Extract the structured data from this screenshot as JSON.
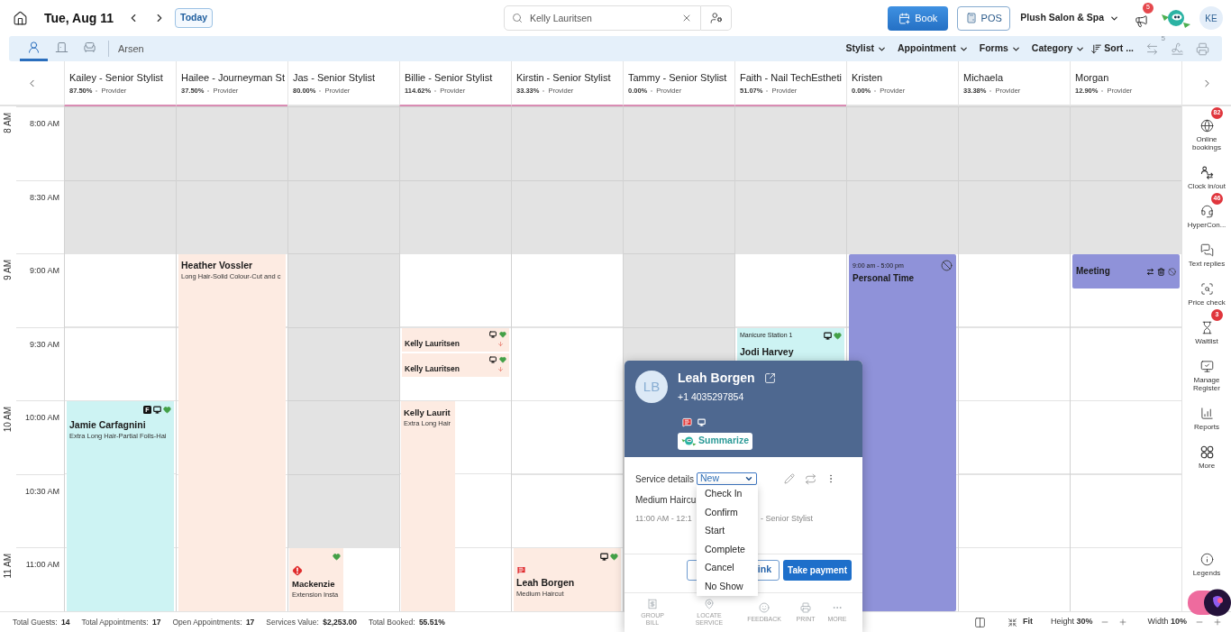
{
  "top_bar": {
    "date": "Tue, Aug 11",
    "today_button": "Today",
    "search": {
      "value": "Kelly Lauritsen"
    },
    "book_button": "Book",
    "pos_button": "POS",
    "business": "Plush Salon & Spa",
    "announcements_badge": "5",
    "user_initials": "KE"
  },
  "toolbar": {
    "views": [
      {
        "selected": true
      },
      {
        "selected": false
      },
      {
        "selected": false
      }
    ],
    "location": "Arsen",
    "filters": [
      "Stylist",
      "Appointment",
      "Forms",
      "Category"
    ],
    "sort": "Sort ...",
    "sync_badge": "5"
  },
  "time_slots": [
    {
      "hour_label": "8 AM",
      "label": "8:00 AM"
    },
    {
      "label": "8:30 AM"
    },
    {
      "hour_label": "9 AM",
      "label": "9:00 AM"
    },
    {
      "label": "9:30 AM"
    },
    {
      "hour_label": "10 AM",
      "label": "10:00 AM"
    },
    {
      "label": "10:30 AM"
    },
    {
      "hour_label": "11 AM",
      "label": "11:00 AM"
    }
  ],
  "stylists": [
    {
      "name": "Kailey - Senior Stylist",
      "booked": "87.50%",
      "role": "Provider",
      "underlined": true,
      "slots": [
        {
          "available": false
        },
        {
          "available": false
        },
        {
          "available": true
        },
        {
          "available": true
        },
        {
          "available": true,
          "appointments": [
            {
              "kind": "appointment",
              "client": "Jamie Carfagnini",
              "service": "Extra Long Hair-Partial Foils-Hai",
              "color": "#cdf3f3",
              "half_width": false,
              "indicators": [
                {
                  "kind": "letter",
                  "text": "F"
                },
                {
                  "kind": "monitor"
                },
                {
                  "kind": "heart"
                }
              ]
            }
          ]
        }
      ]
    },
    {
      "name": "Hailee - Journeyman St",
      "booked": "37.50%",
      "role": "Provider",
      "underlined": true,
      "slots": [
        {
          "available": false
        },
        {
          "available": false
        },
        {
          "available": true,
          "appointments": [
            {
              "kind": "appointment",
              "client": "Heather Vossler",
              "service": "Long Hair-Solid Colour-Cut and c",
              "color": "#fdebe2",
              "half_width": false
            }
          ]
        }
      ]
    },
    {
      "name": "Jas - Senior Stylist",
      "booked": "80.00%",
      "role": "Provider",
      "underlined": false,
      "slots": [
        {
          "available": false
        },
        {
          "available": false
        },
        {
          "available": false
        },
        {
          "available": false
        },
        {
          "available": false
        },
        {
          "available": false
        },
        {
          "available": true,
          "appointments": [
            {
              "kind": "appointment",
              "client": "Mackenzie",
              "service": "Extension Insta",
              "color": "#fdebe2",
              "half_width": true,
              "flag": {
                "kind": "alert"
              },
              "indicators": [
                {
                  "kind": "heart"
                }
              ]
            }
          ]
        }
      ]
    },
    {
      "name": "Billie - Senior Stylist",
      "booked": "114.62%",
      "role": "Provider",
      "underlined": true,
      "slots": [
        {
          "available": false
        },
        {
          "available": false
        },
        {
          "available": true
        },
        {
          "available": true,
          "appointments": [
            {
              "kind": "appointment",
              "client": "Kelly Lauritsen",
              "color": "#fdebe2",
              "half_width": false,
              "indicators": [
                {
                  "kind": "monitor"
                },
                {
                  "kind": "heart"
                },
                {
                  "kind": "arrow-down"
                }
              ]
            },
            {
              "kind": "appointment",
              "client": "Kelly Lauritsen",
              "color": "#fdebe2",
              "half_width": false,
              "indicators": [
                {
                  "kind": "monitor"
                },
                {
                  "kind": "heart"
                },
                {
                  "kind": "arrow-down"
                }
              ]
            }
          ]
        },
        {
          "available": true,
          "appointments": [
            {
              "kind": "appointment",
              "client": "Kelly Laurit",
              "service": "Extra Long Hair",
              "color": "#fdebe2",
              "half_width": true
            }
          ]
        }
      ]
    },
    {
      "name": "Kirstin - Senior Stylist",
      "booked": "33.33%",
      "role": "Provider",
      "underlined": true,
      "slots": [
        {
          "available": false
        },
        {
          "available": false
        },
        {
          "available": true
        },
        {
          "available": true
        },
        {
          "available": true
        },
        {
          "available": true
        },
        {
          "available": true,
          "appointments": [
            {
              "kind": "appointment",
              "client": "Leah Borgen",
              "service": "Medium Haircut",
              "color": "#fdebe2",
              "half_width": false,
              "flag": {
                "kind": "note"
              },
              "indicators": [
                {
                  "kind": "monitor"
                },
                {
                  "kind": "heart"
                }
              ]
            }
          ]
        }
      ]
    },
    {
      "name": "Tammy - Senior Stylist",
      "booked": "0.00%",
      "role": "Provider",
      "underlined": true,
      "slots": [
        {
          "available": false
        },
        {
          "available": false
        },
        {
          "available": false
        },
        {
          "available": false
        }
      ]
    },
    {
      "name": "Faith - Nail TechEstheti",
      "booked": "51.07%",
      "role": "Provider",
      "underlined": true,
      "slots": [
        {
          "available": false
        },
        {
          "available": false
        },
        {
          "available": true
        },
        {
          "available": true,
          "appointments": [
            {
              "kind": "appointment",
              "station": "Manicure Station 1",
              "client": "Jodi Harvey",
              "color": "#cdf3f3",
              "half_width": false,
              "indicators": [
                {
                  "kind": "monitor"
                },
                {
                  "kind": "heart"
                }
              ]
            }
          ]
        }
      ]
    },
    {
      "name": "Kristen",
      "booked": "0.00%",
      "role": "Provider",
      "underlined": false,
      "slots": [
        {
          "available": false
        },
        {
          "available": false
        },
        {
          "available": true,
          "appointments": [
            {
              "kind": "block",
              "time": "9:00 am - 5:00 pm",
              "title": "Personal Time",
              "color": "#8f92d9",
              "half_width": false,
              "indicators": [
                {
                  "kind": "blocked"
                }
              ]
            }
          ]
        }
      ]
    },
    {
      "name": "Michaela",
      "booked": "33.38%",
      "role": "Provider",
      "underlined": false,
      "slots": [
        {
          "available": false
        },
        {
          "available": false
        },
        {
          "available": true
        },
        {
          "available": true
        },
        {
          "available": true
        },
        {
          "available": true
        },
        {
          "available": true
        }
      ]
    },
    {
      "name": "Morgan",
      "booked": "12.90%",
      "role": "Provider",
      "underlined": false,
      "slots": [
        {
          "available": false
        },
        {
          "available": false
        },
        {
          "available": true,
          "appointments": [
            {
              "kind": "block",
              "title": "Meeting",
              "color": "#8f92d9",
              "half_width": false,
              "indicators": [
                {
                  "kind": "swap"
                },
                {
                  "kind": "trash"
                },
                {
                  "kind": "blocked"
                }
              ]
            }
          ]
        },
        {
          "available": true
        },
        {
          "available": true
        },
        {
          "available": true
        },
        {
          "available": true
        }
      ]
    }
  ],
  "popup": {
    "initials": "LB",
    "client": "Leah Borgen",
    "phone": "+1 4035297854",
    "indicators": [
      {
        "kind": "note"
      },
      {
        "kind": "monitor"
      }
    ],
    "summarize_button": "Summarize",
    "section_label": "Service details",
    "status": {
      "value": "New",
      "expanded": true,
      "options": [
        {
          "label": "Check In",
          "selected": false
        },
        {
          "label": "Confirm",
          "selected": false
        },
        {
          "label": "Start",
          "selected": false
        },
        {
          "label": "Complete",
          "selected": false
        },
        {
          "label": "Cancel",
          "selected": false
        },
        {
          "label": "No Show",
          "selected": false
        }
      ]
    },
    "service": "Medium Haircu",
    "time": "11:00 AM - 12:1",
    "provider": "- Senior Stylist",
    "buttons": [
      {
        "label": "ink",
        "kind": "outline"
      },
      {
        "label": "Take payment",
        "kind": "primary"
      }
    ],
    "actions": [
      "GROUP BILL",
      "LOCATE SERVICE",
      "FEEDBACK",
      "PRINT",
      "MORE"
    ]
  },
  "sidebar": {
    "items": [
      {
        "label": "Online bookings",
        "badge": "82"
      },
      {
        "label": "Clock in/out"
      },
      {
        "label": "HyperCon...",
        "badge": "46"
      },
      {
        "label": "Text replies"
      },
      {
        "label": "Price check"
      },
      {
        "label": "Waitlist",
        "badge": "3"
      },
      {
        "label": "Manage Register"
      },
      {
        "label": "Reports"
      },
      {
        "label": "More"
      }
    ],
    "legends": "Legends"
  },
  "status_bar": {
    "stats": [
      {
        "label": "Total Guests:",
        "value": "14"
      },
      {
        "label": "Total Appointments:",
        "value": "17"
      },
      {
        "label": "Open Appointments:",
        "value": "17"
      },
      {
        "label": "Services Value:",
        "value": "$2,253.00"
      },
      {
        "label": "Total Booked:",
        "value": "55.51%"
      }
    ],
    "fit_button": "Fit",
    "height": {
      "label": "Height",
      "value": "30%"
    },
    "width": {
      "label": "Width",
      "value": "10%"
    }
  }
}
